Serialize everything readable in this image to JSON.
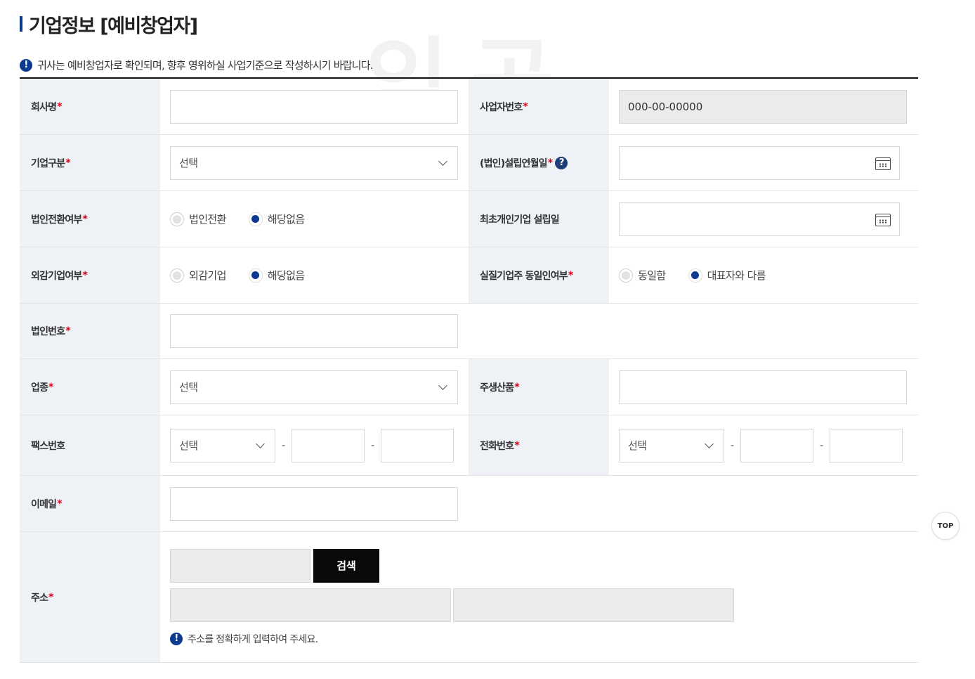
{
  "page": {
    "title": "기업정보 [예비창업자]",
    "notice": "귀사는 예비창업자로 확인되며, 향후 영위하실 사업기준으로 작성하시기 바랍니다.",
    "watermark": "익곡"
  },
  "icons": {
    "info": "!",
    "help": "?"
  },
  "required_mark": "*",
  "fields": {
    "company_name": {
      "label": "회사명",
      "value": ""
    },
    "business_number": {
      "label": "사업자번호",
      "value": "000-00-00000"
    },
    "company_type": {
      "label": "기업구분",
      "value": "선택"
    },
    "establish_date": {
      "label": "(법인)설립연월일",
      "value": ""
    },
    "corp_conversion": {
      "label": "법인전환여부",
      "options": [
        "법인전환",
        "해당없음"
      ],
      "selected": "해당없음"
    },
    "first_personal_date": {
      "label": "최초개인기업 설립일",
      "value": ""
    },
    "external_audit": {
      "label": "외감기업여부",
      "options": [
        "외감기업",
        "해당없음"
      ],
      "selected": "해당없음"
    },
    "owner_same": {
      "label": "실질기업주 동일인여부",
      "options": [
        "동일함",
        "대표자와 다름"
      ],
      "selected": "대표자와 다름"
    },
    "corp_number": {
      "label": "법인번호",
      "value": ""
    },
    "industry": {
      "label": "업종",
      "value": "선택"
    },
    "main_product": {
      "label": "주생산품",
      "value": ""
    },
    "fax": {
      "label": "팩스번호",
      "prefix": "선택",
      "mid": "",
      "last": ""
    },
    "phone": {
      "label": "전화번호",
      "prefix": "선택",
      "mid": "",
      "last": ""
    },
    "email": {
      "label": "이메일",
      "value": ""
    },
    "address": {
      "label": "주소",
      "search_label": "검색",
      "note": "주소를 정확하게 입력하여 주세요."
    }
  },
  "top_button": "TOP",
  "colors": {
    "accent": "#0b3a8f",
    "header_bg": "#eef2f7",
    "required": "#d9001b"
  }
}
